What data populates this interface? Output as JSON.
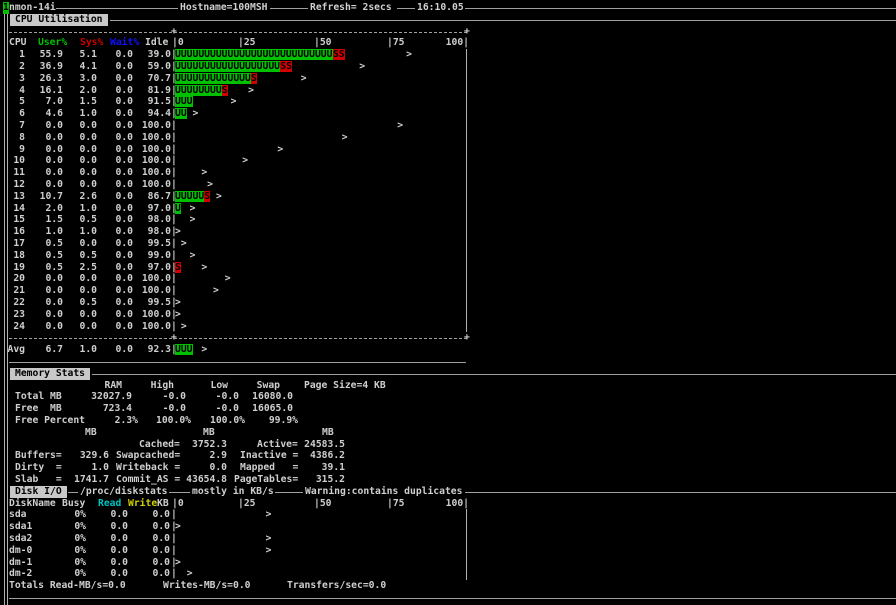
{
  "header": {
    "cursor": "1",
    "app": "nmon-14i",
    "hostname": "Hostname=100MSH",
    "refresh": "Refresh= 2secs",
    "time": "16:10.05"
  },
  "cpu": {
    "title": "CPU Utilisation",
    "columns": {
      "cpu": "CPU",
      "user": "User%",
      "sys": "Sys%",
      "wait": "Wait%",
      "idle": "Idle"
    },
    "scale": [
      "|0",
      "|25",
      "|50",
      "|75",
      "100|"
    ],
    "bar_chars": {
      "user": "U",
      "sys": "S",
      "peak": ">"
    },
    "colors": {
      "user": "#00c000",
      "sys": "#d00000",
      "wait": "#1010ff"
    },
    "rows": [
      {
        "cpu": "1",
        "user": "55.9",
        "sys": "5.1",
        "wait": "0.0",
        "idle": "39.0",
        "peak": 79
      },
      {
        "cpu": "2",
        "user": "36.9",
        "sys": "4.1",
        "wait": "0.0",
        "idle": "59.0",
        "peak": 63
      },
      {
        "cpu": "3",
        "user": "26.3",
        "sys": "3.0",
        "wait": "0.0",
        "idle": "70.7",
        "peak": 43
      },
      {
        "cpu": "4",
        "user": "16.1",
        "sys": "2.0",
        "wait": "0.0",
        "idle": "81.9",
        "peak": 25
      },
      {
        "cpu": "5",
        "user": "7.0",
        "sys": "1.5",
        "wait": "0.0",
        "idle": "91.5",
        "peak": 19
      },
      {
        "cpu": "6",
        "user": "4.6",
        "sys": "1.0",
        "wait": "0.0",
        "idle": "94.4",
        "peak": 6
      },
      {
        "cpu": "7",
        "user": "0.0",
        "sys": "0.0",
        "wait": "0.0",
        "idle": "100.0",
        "peak": 76
      },
      {
        "cpu": "8",
        "user": "0.0",
        "sys": "0.0",
        "wait": "0.0",
        "idle": "100.0",
        "peak": 57
      },
      {
        "cpu": "9",
        "user": "0.0",
        "sys": "0.0",
        "wait": "0.0",
        "idle": "100.0",
        "peak": 35
      },
      {
        "cpu": "10",
        "user": "0.0",
        "sys": "0.0",
        "wait": "0.0",
        "idle": "100.0",
        "peak": 23
      },
      {
        "cpu": "11",
        "user": "0.0",
        "sys": "0.0",
        "wait": "0.0",
        "idle": "100.0",
        "peak": 9
      },
      {
        "cpu": "12",
        "user": "0.0",
        "sys": "0.0",
        "wait": "0.0",
        "idle": "100.0",
        "peak": 11
      },
      {
        "cpu": "13",
        "user": "10.7",
        "sys": "2.6",
        "wait": "0.0",
        "idle": "86.7",
        "peak": 14
      },
      {
        "cpu": "14",
        "user": "2.0",
        "sys": "1.0",
        "wait": "0.0",
        "idle": "97.0",
        "peak": 5
      },
      {
        "cpu": "15",
        "user": "1.5",
        "sys": "0.5",
        "wait": "0.0",
        "idle": "98.0",
        "peak": 5
      },
      {
        "cpu": "16",
        "user": "1.0",
        "sys": "1.0",
        "wait": "0.0",
        "idle": "98.0",
        "peak": 0
      },
      {
        "cpu": "17",
        "user": "0.5",
        "sys": "0.0",
        "wait": "0.0",
        "idle": "99.5",
        "peak": 2
      },
      {
        "cpu": "18",
        "user": "0.5",
        "sys": "0.5",
        "wait": "0.0",
        "idle": "99.0",
        "peak": 5
      },
      {
        "cpu": "19",
        "user": "0.5",
        "sys": "2.5",
        "wait": "0.0",
        "idle": "97.0",
        "peak": 9
      },
      {
        "cpu": "20",
        "user": "0.0",
        "sys": "0.0",
        "wait": "0.0",
        "idle": "100.0",
        "peak": 17
      },
      {
        "cpu": "21",
        "user": "0.0",
        "sys": "0.0",
        "wait": "0.0",
        "idle": "100.0",
        "peak": 13
      },
      {
        "cpu": "22",
        "user": "0.0",
        "sys": "0.5",
        "wait": "0.0",
        "idle": "99.5",
        "peak": 0
      },
      {
        "cpu": "23",
        "user": "0.0",
        "sys": "0.0",
        "wait": "0.0",
        "idle": "100.0",
        "peak": 0
      },
      {
        "cpu": "24",
        "user": "0.0",
        "sys": "0.0",
        "wait": "0.0",
        "idle": "100.0",
        "peak": 2
      }
    ],
    "avg": {
      "cpu": "Avg",
      "user": "6.7",
      "sys": "1.0",
      "wait": "0.0",
      "idle": "92.3",
      "peak": 9
    }
  },
  "memory": {
    "title": "Memory Stats",
    "columns": [
      "RAM",
      "High",
      "Low",
      "Swap"
    ],
    "page_size": "Page Size=4 KB",
    "rows": [
      {
        "label": "Total MB",
        "values": [
          "32027.9",
          "-0.0",
          "-0.0",
          "16080.0"
        ]
      },
      {
        "label": "Free  MB",
        "values": [
          "723.4",
          "-0.0",
          "-0.0",
          "16065.0"
        ]
      },
      {
        "label": "Free Percent",
        "values": [
          "2.3%",
          "100.0%",
          "100.0%",
          "99.9%"
        ]
      }
    ],
    "unit": "MB",
    "stats": [
      [
        {
          "label": "",
          "value": ""
        },
        {
          "label": "Cached=",
          "value": "3752.3"
        },
        {
          "label": "Active=",
          "value": "24583.5"
        }
      ],
      [
        {
          "label": "Buffers=",
          "value": "329.6"
        },
        {
          "label": "Swapcached=",
          "value": "2.9"
        },
        {
          "label": "Inactive =",
          "value": "4386.2"
        }
      ],
      [
        {
          "label": "Dirty  =",
          "value": "1.0"
        },
        {
          "label": "Writeback =",
          "value": "0.0"
        },
        {
          "label": "Mapped   =",
          "value": "39.1"
        }
      ],
      [
        {
          "label": "Slab   =",
          "value": "1741.7"
        },
        {
          "label": "Commit_AS =",
          "value": "43654.8"
        },
        {
          "label": "PageTables=",
          "value": "315.2"
        }
      ]
    ]
  },
  "disk": {
    "title": "Disk I/O",
    "source": "/proc/diskstats",
    "units_note": "mostly in KB/s",
    "warning": "Warning:contains duplicates",
    "columns": {
      "name": "DiskName",
      "busy": "Busy",
      "read": "Read",
      "write": "Write",
      "kb": "KB"
    },
    "colors": {
      "read": "#00c0c0",
      "write": "#d0d000"
    },
    "scale": [
      "|0",
      "|25",
      "|50",
      "|75",
      "100|"
    ],
    "rows": [
      {
        "name": "sda",
        "busy": "0%",
        "read": "0.0",
        "write": "0.0",
        "peak": 31
      },
      {
        "name": "sda1",
        "busy": "0%",
        "read": "0.0",
        "write": "0.0",
        "peak": 0
      },
      {
        "name": "sda2",
        "busy": "0%",
        "read": "0.0",
        "write": "0.0",
        "peak": 31
      },
      {
        "name": "dm-0",
        "busy": "0%",
        "read": "0.0",
        "write": "0.0",
        "peak": 31
      },
      {
        "name": "dm-1",
        "busy": "0%",
        "read": "0.0",
        "write": "0.0",
        "peak": 0
      },
      {
        "name": "dm-2",
        "busy": "0%",
        "read": "0.0",
        "write": "0.0",
        "peak": 4
      }
    ],
    "totals": {
      "read": "Totals Read-MB/s=0.0",
      "write": "Writes-MB/s=0.0",
      "transfers": "Transfers/sec=0.0"
    }
  }
}
